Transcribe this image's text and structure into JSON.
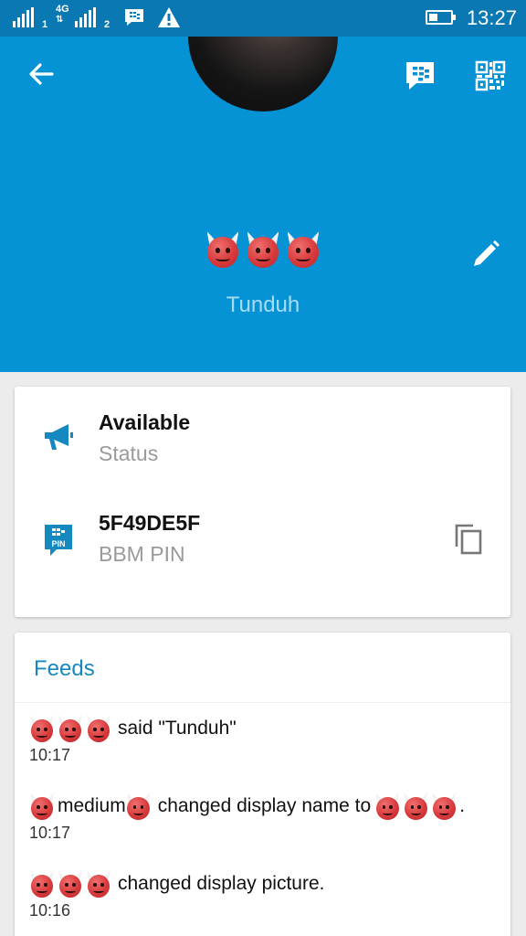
{
  "status_bar": {
    "sim1": "1",
    "network_type": "4G",
    "sim2": "2",
    "time": "13:27",
    "battery_level": 0.4,
    "icons": [
      "signal-icon",
      "bbm-notification-icon",
      "warning-icon",
      "battery-icon"
    ]
  },
  "header": {
    "background_color": "#0593d6",
    "display_name_emoji": [
      "smiling-devil-emoji",
      "smiling-devil-emoji",
      "smiling-devil-emoji"
    ],
    "username": "Tunduh",
    "actions": [
      "back-arrow-icon",
      "bbm-chat-icon",
      "qr-code-icon",
      "edit-pencil-icon"
    ]
  },
  "info": {
    "status_value": "Available",
    "status_label": "Status",
    "pin_value": "5F49DE5F",
    "pin_label": "BBM PIN",
    "pin_icon_text": "PIN",
    "accent_color": "#1688c0"
  },
  "feeds": {
    "title": "Feeds",
    "items": [
      {
        "text": "said \"Tunduh\"",
        "time": "10:17"
      },
      {
        "name_text": "medium",
        "text": "changed display name to",
        "end": ".",
        "time": "10:17"
      },
      {
        "text": "changed display picture.",
        "time": "10:16"
      }
    ]
  }
}
